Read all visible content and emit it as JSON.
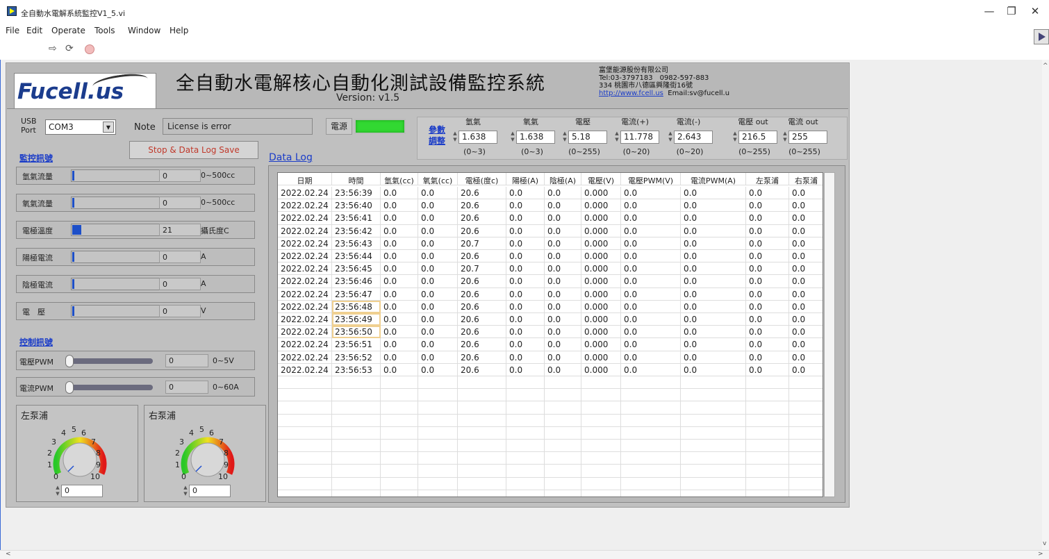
{
  "window": {
    "title": "全自動水電解系統監控V1_5.vi",
    "minimize": "—",
    "restore": "❐",
    "close": "✕"
  },
  "menu": [
    "File",
    "Edit",
    "Operate",
    "Tools",
    "Window",
    "Help"
  ],
  "toolbar": {
    "run_arrow": "⇨",
    "run_continuous": "⟳"
  },
  "header": {
    "logo": "Fucell.us",
    "title": "全自動水電解核心自動化測試設備監控系統",
    "version": "Version: v1.5",
    "company": {
      "name": "富堡能源股份有限公司",
      "tel": "Tel:03-3797183　0982-597-883",
      "address": "334 桃園市八德區興隆街16號",
      "url": "http://www.fcell.us",
      "email": "Email:sv@fucell.u"
    }
  },
  "controls": {
    "usb_label_1": "USB",
    "usb_label_2": "Port",
    "usb_port": "COM3",
    "note_label": "Note",
    "note_value": "License is error",
    "stop_button": "Stop & Data Log Save",
    "power_label": "電源",
    "power_on": true,
    "power_led_color": "#32d832"
  },
  "monitor": {
    "title": "監控訊號",
    "items": [
      {
        "name": "氫氣流量",
        "value": "0",
        "unit": "0~500cc",
        "fill": 0.0
      },
      {
        "name": "氧氣流量",
        "value": "0",
        "unit": "0~500cc",
        "fill": 0.0
      },
      {
        "name": "電極溫度",
        "value": "21",
        "unit": "攝氏度C",
        "fill": 0.1
      },
      {
        "name": "陽極電流",
        "value": "0",
        "unit": "A",
        "fill": 0.0
      },
      {
        "name": "陰極電流",
        "value": "0",
        "unit": "A",
        "fill": 0.0
      },
      {
        "name": "電　壓",
        "value": "0",
        "unit": "V",
        "fill": 0.0
      }
    ]
  },
  "control_signals": {
    "title": "控制訊號",
    "items": [
      {
        "name": "電壓PWM",
        "value": "0",
        "unit": "0~5V"
      },
      {
        "name": "電流PWM",
        "value": "0",
        "unit": "0~60A"
      }
    ]
  },
  "pumps": {
    "ticks": [
      "0",
      "1",
      "2",
      "3",
      "4",
      "5",
      "6",
      "7",
      "8",
      "9",
      "10"
    ],
    "left": {
      "title": "左泵浦",
      "value": "0"
    },
    "right": {
      "title": "右泵浦",
      "value": "0"
    }
  },
  "params": {
    "link_1": "參數",
    "link_2": "調整",
    "items": [
      {
        "header": "氫氣",
        "value": "1.638",
        "range": "(0~3)"
      },
      {
        "header": "氧氣",
        "value": "1.638",
        "range": "(0~3)"
      },
      {
        "header": "電壓",
        "value": "5.18",
        "range": "(0~255)"
      },
      {
        "header": "電流(+)",
        "value": "11.778",
        "range": "(0~20)"
      },
      {
        "header": "電流(-)",
        "value": "2.643",
        "range": "(0~20)"
      },
      {
        "header": "電壓 out",
        "value": "216.5",
        "range": "(0~255)"
      },
      {
        "header": "電流 out",
        "value": "255",
        "range": "(0~255)"
      }
    ]
  },
  "datalog": {
    "title": "Data Log",
    "columns": [
      "日期",
      "時間",
      "氫氣(cc)",
      "氧氣(cc)",
      "電極(度c)",
      "陽極(A)",
      "陰極(A)",
      "電壓(V)",
      "電壓PWM(V)",
      "電流PWM(A)",
      "左泵浦",
      "右泵浦"
    ],
    "rows": [
      [
        "2022.02.24",
        "23:56:39",
        "0.0",
        "0.0",
        "20.6",
        "0.0",
        "0.0",
        "0.000",
        "0.0",
        "0.0",
        "0.0",
        "0.0"
      ],
      [
        "2022.02.24",
        "23:56:40",
        "0.0",
        "0.0",
        "20.6",
        "0.0",
        "0.0",
        "0.000",
        "0.0",
        "0.0",
        "0.0",
        "0.0"
      ],
      [
        "2022.02.24",
        "23:56:41",
        "0.0",
        "0.0",
        "20.6",
        "0.0",
        "0.0",
        "0.000",
        "0.0",
        "0.0",
        "0.0",
        "0.0"
      ],
      [
        "2022.02.24",
        "23:56:42",
        "0.0",
        "0.0",
        "20.6",
        "0.0",
        "0.0",
        "0.000",
        "0.0",
        "0.0",
        "0.0",
        "0.0"
      ],
      [
        "2022.02.24",
        "23:56:43",
        "0.0",
        "0.0",
        "20.7",
        "0.0",
        "0.0",
        "0.000",
        "0.0",
        "0.0",
        "0.0",
        "0.0"
      ],
      [
        "2022.02.24",
        "23:56:44",
        "0.0",
        "0.0",
        "20.6",
        "0.0",
        "0.0",
        "0.000",
        "0.0",
        "0.0",
        "0.0",
        "0.0"
      ],
      [
        "2022.02.24",
        "23:56:45",
        "0.0",
        "0.0",
        "20.7",
        "0.0",
        "0.0",
        "0.000",
        "0.0",
        "0.0",
        "0.0",
        "0.0"
      ],
      [
        "2022.02.24",
        "23:56:46",
        "0.0",
        "0.0",
        "20.6",
        "0.0",
        "0.0",
        "0.000",
        "0.0",
        "0.0",
        "0.0",
        "0.0"
      ],
      [
        "2022.02.24",
        "23:56:47",
        "0.0",
        "0.0",
        "20.6",
        "0.0",
        "0.0",
        "0.000",
        "0.0",
        "0.0",
        "0.0",
        "0.0"
      ],
      [
        "2022.02.24",
        "23:56:48",
        "0.0",
        "0.0",
        "20.6",
        "0.0",
        "0.0",
        "0.000",
        "0.0",
        "0.0",
        "0.0",
        "0.0"
      ],
      [
        "2022.02.24",
        "23:56:49",
        "0.0",
        "0.0",
        "20.6",
        "0.0",
        "0.0",
        "0.000",
        "0.0",
        "0.0",
        "0.0",
        "0.0"
      ],
      [
        "2022.02.24",
        "23:56:50",
        "0.0",
        "0.0",
        "20.6",
        "0.0",
        "0.0",
        "0.000",
        "0.0",
        "0.0",
        "0.0",
        "0.0"
      ],
      [
        "2022.02.24",
        "23:56:51",
        "0.0",
        "0.0",
        "20.6",
        "0.0",
        "0.0",
        "0.000",
        "0.0",
        "0.0",
        "0.0",
        "0.0"
      ],
      [
        "2022.02.24",
        "23:56:52",
        "0.0",
        "0.0",
        "20.6",
        "0.0",
        "0.0",
        "0.000",
        "0.0",
        "0.0",
        "0.0",
        "0.0"
      ],
      [
        "2022.02.24",
        "23:56:53",
        "0.0",
        "0.0",
        "20.6",
        "0.0",
        "0.0",
        "0.000",
        "0.0",
        "0.0",
        "0.0",
        "0.0"
      ]
    ],
    "highlighted_time_rows": [
      9,
      10,
      11
    ]
  }
}
